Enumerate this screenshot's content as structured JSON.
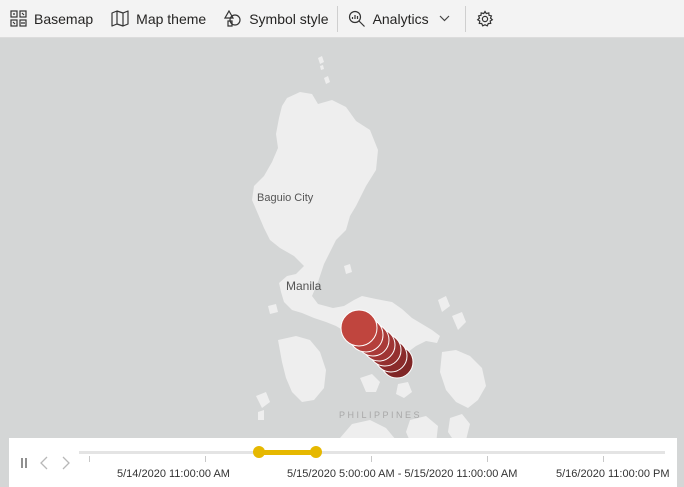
{
  "toolbar": {
    "basemap_label": "Basemap",
    "map_theme_label": "Map theme",
    "symbol_style_label": "Symbol style",
    "analytics_label": "Analytics"
  },
  "map": {
    "places": [
      "Baguio City",
      "Manila"
    ],
    "country": "PHILIPPINES",
    "symbol_color": "#c0453e"
  },
  "timeline": {
    "start_label": "5/14/2020 11:00:00 AM",
    "range_label": "5/15/2020 5:00:00 AM - 5/15/2020 11:00:00 AM",
    "end_label": "5/16/2020 11:00:00 PM",
    "accent_color": "#e6b800"
  }
}
